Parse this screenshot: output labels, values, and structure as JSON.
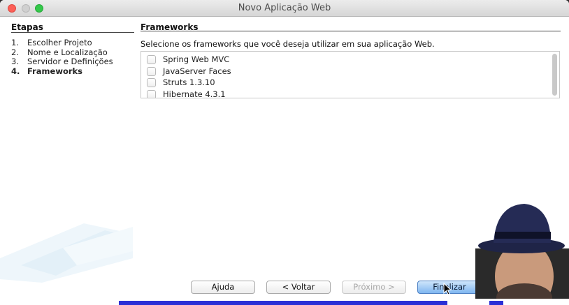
{
  "window": {
    "title": "Novo Aplicação Web"
  },
  "steps": {
    "heading": "Etapas",
    "items": [
      {
        "num": "1.",
        "label": "Escolher Projeto",
        "current": false
      },
      {
        "num": "2.",
        "label": "Nome e Localização",
        "current": false
      },
      {
        "num": "3.",
        "label": "Servidor e Definições",
        "current": false
      },
      {
        "num": "4.",
        "label": "Frameworks",
        "current": true
      }
    ]
  },
  "content": {
    "heading": "Frameworks",
    "instruction": "Selecione os frameworks que você deseja utilizar em sua aplicação Web.",
    "frameworks": [
      {
        "label": "Spring Web MVC",
        "checked": false
      },
      {
        "label": "JavaServer Faces",
        "checked": false
      },
      {
        "label": "Struts 1.3.10",
        "checked": false
      },
      {
        "label": "Hibernate 4.3.1",
        "checked": false
      }
    ]
  },
  "buttons": {
    "help": "Ajuda",
    "back": "< Voltar",
    "next": "Próximo >",
    "finish": "Finalizar"
  },
  "colors": {
    "accent": "#7fb6f0",
    "close": "#fc5f57",
    "maximize": "#34c84a"
  }
}
